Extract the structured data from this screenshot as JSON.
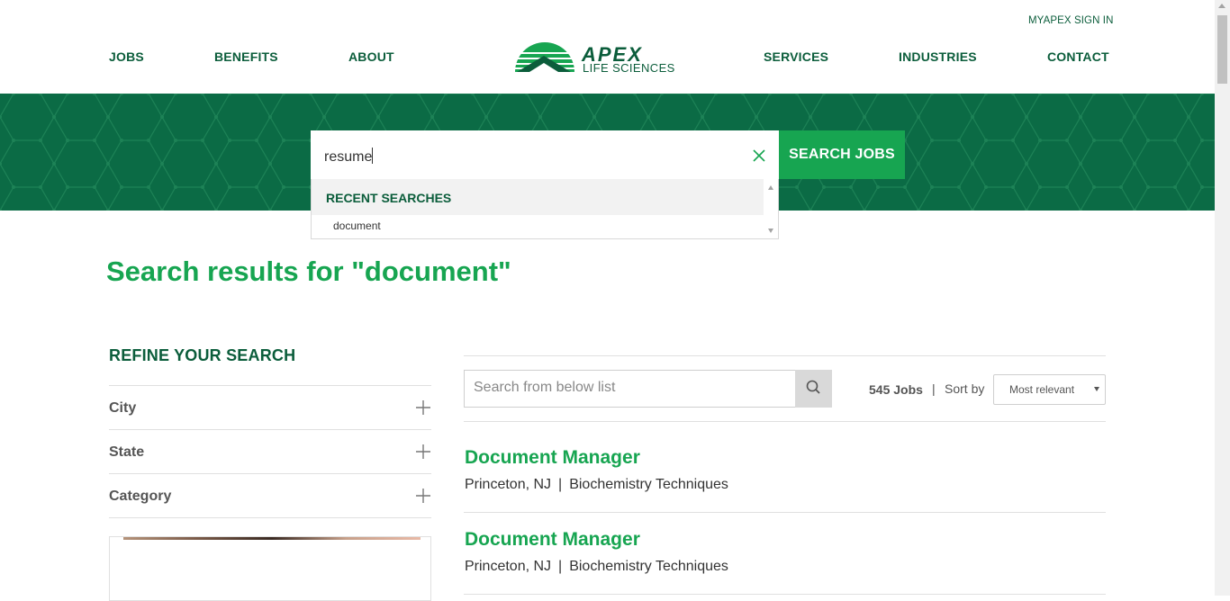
{
  "header": {
    "signin": "MYAPEX SIGN IN",
    "nav_left": [
      "JOBS",
      "BENEFITS",
      "ABOUT"
    ],
    "nav_right": [
      "SERVICES",
      "INDUSTRIES",
      "CONTACT"
    ],
    "logo_line1": "APEX",
    "logo_line2": "LIFE SCIENCES"
  },
  "colors": {
    "brand_dark": "#0b5d3b",
    "brand_green": "#17a551",
    "hero_bg": "#0b6b45"
  },
  "search": {
    "value": "resume",
    "button": "SEARCH JOBS",
    "clear_icon": "close-icon"
  },
  "recent": {
    "title": "RECENT SEARCHES",
    "items": [
      "document"
    ]
  },
  "results_title": "Search results for \"document\"",
  "refine": {
    "title": "REFINE YOUR SEARCH",
    "filters": [
      "City",
      "State",
      "Category"
    ]
  },
  "list": {
    "search_placeholder": "Search from below list",
    "count": "545 Jobs",
    "sort_label": "Sort by",
    "sort_value": "Most relevant"
  },
  "jobs": [
    {
      "title": "Document Manager",
      "location": "Princeton, NJ",
      "category": "Biochemistry Techniques"
    },
    {
      "title": "Document Manager",
      "location": "Princeton, NJ",
      "category": "Biochemistry Techniques"
    }
  ]
}
